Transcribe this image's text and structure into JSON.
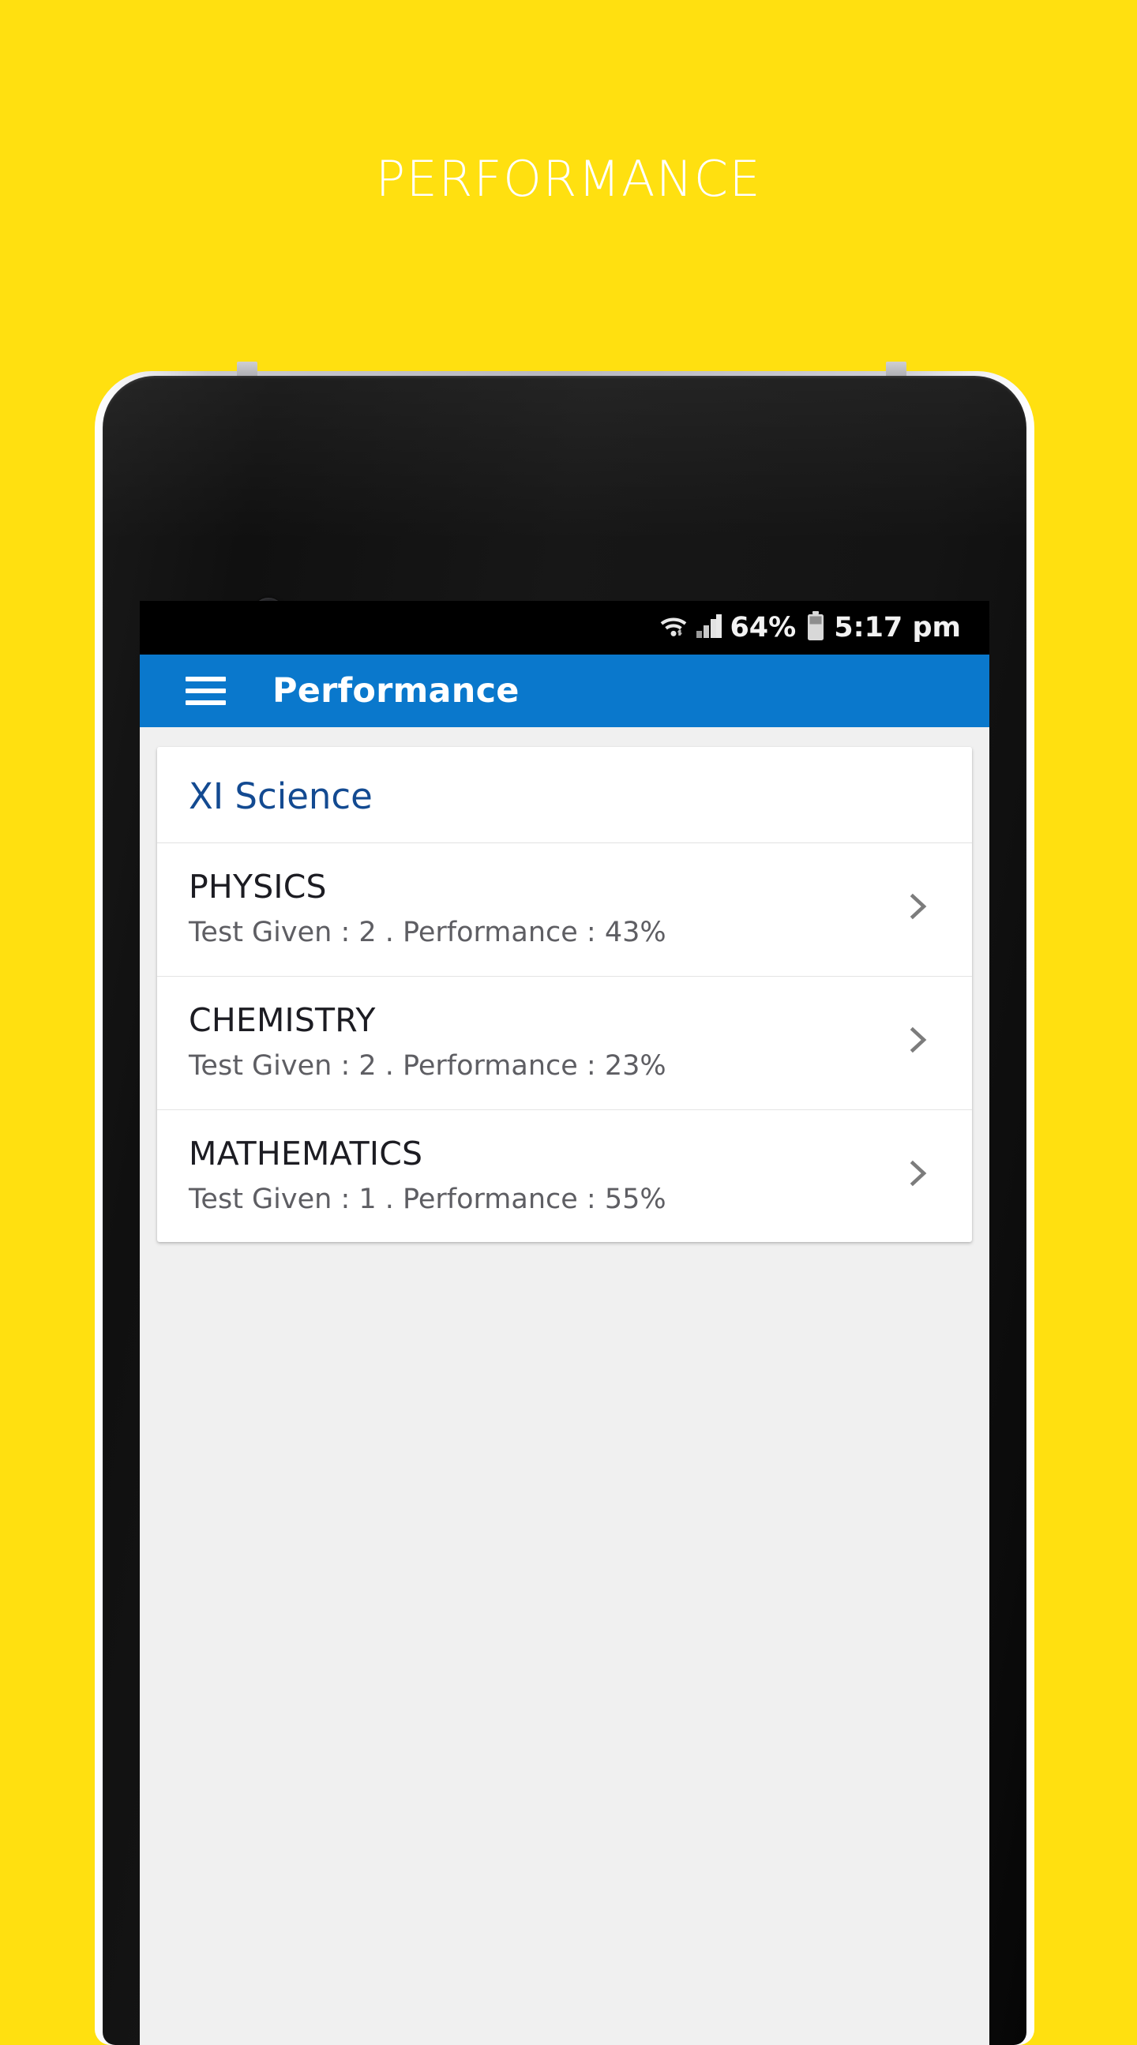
{
  "promo": {
    "headline": "PERFORMANCE",
    "background_color": "#FFE010",
    "headline_color": "#FFFFFF"
  },
  "phone": {
    "status_bar": {
      "wifi_icon": "wifi-icon",
      "signal_icon": "cellular-signal-icon",
      "battery_percent": "64%",
      "battery_icon": "battery-icon",
      "clock": "5:17 pm",
      "background_color": "#000000"
    },
    "app_bar": {
      "menu_icon": "hamburger-menu-icon",
      "title": "Performance",
      "background_color": "#0A78CC",
      "text_color": "#FFFFFF"
    },
    "content": {
      "background_color": "#F0F0F0",
      "card": {
        "header": {
          "title": "XI Science",
          "color": "#134A91"
        },
        "chevron_icon": "chevron-right-icon",
        "subjects": [
          {
            "name": "PHYSICS",
            "meta": "Test Given : 2 . Performance : 43%",
            "tests_given": 2,
            "performance": "43%"
          },
          {
            "name": "CHEMISTRY",
            "meta": "Test Given : 2 . Performance : 23%",
            "tests_given": 2,
            "performance": "23%"
          },
          {
            "name": "MATHEMATICS",
            "meta": "Test Given : 1 . Performance : 55%",
            "tests_given": 1,
            "performance": "55%"
          }
        ]
      }
    }
  }
}
